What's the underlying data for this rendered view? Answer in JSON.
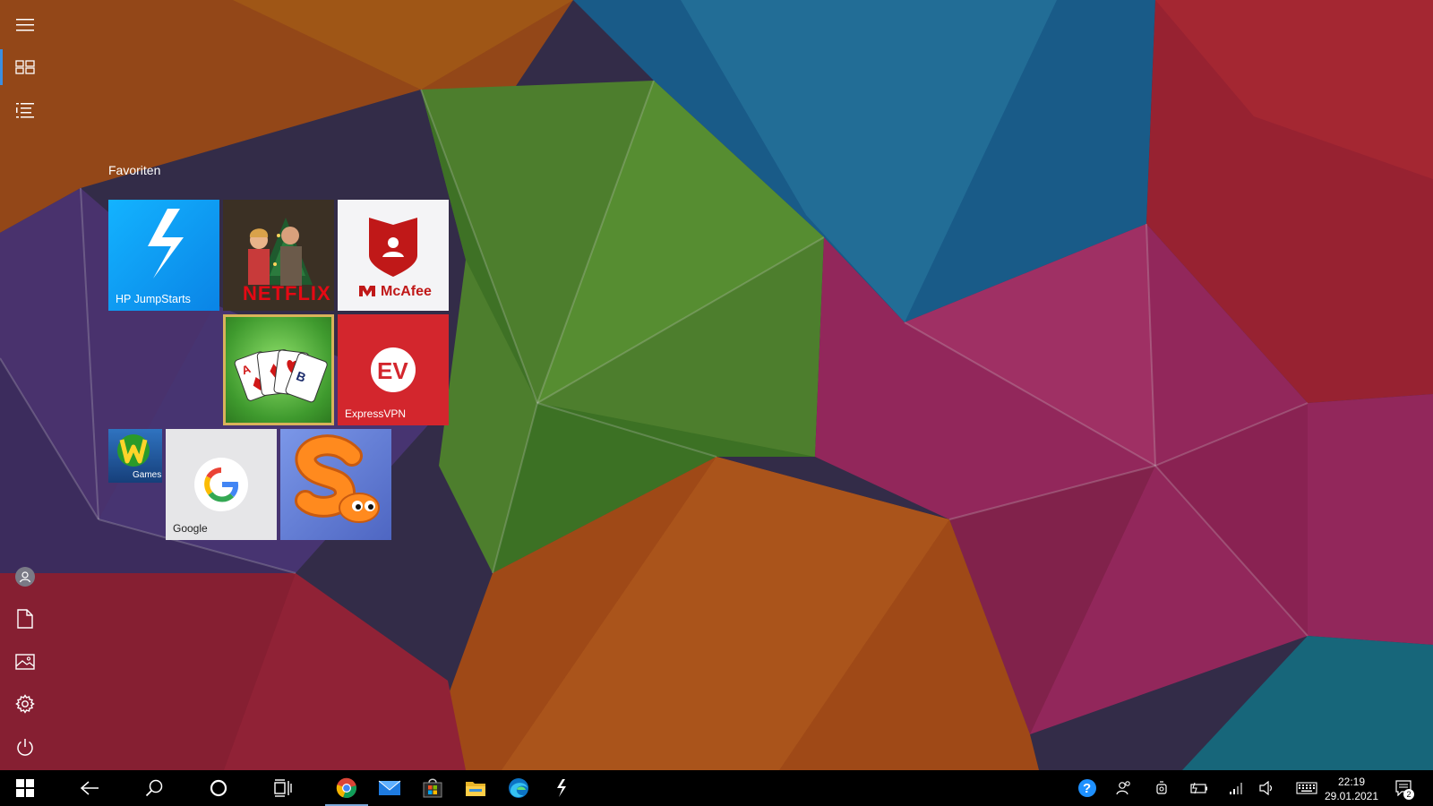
{
  "start": {
    "group_title": "Favoriten",
    "rail_icons": [
      "hamburger-icon",
      "tiles-icon",
      "all-apps-list-icon",
      "user-avatar-icon",
      "documents-icon",
      "pictures-icon",
      "settings-icon",
      "power-icon"
    ],
    "tiles": [
      {
        "name": "HP JumpStarts",
        "label": "HP JumpStarts",
        "bg": "#0a9bf0"
      },
      {
        "name": "Netflix",
        "label": "",
        "logo": "NETFLIX",
        "bg": "#3a2b22"
      },
      {
        "name": "McAfee",
        "label": "",
        "logo": "McAfee",
        "bg": "#f4f4f6"
      },
      {
        "name": "Solitaire",
        "label": "",
        "bg": "#3f9a2e"
      },
      {
        "name": "ExpressVPN",
        "label": "ExpressVPN",
        "bg": "#d3262d"
      },
      {
        "name": "WildTangent Games",
        "label": "Games",
        "bg": "#1e5fa8"
      },
      {
        "name": "Google",
        "label": "Google",
        "bg": "#e6e6e8"
      },
      {
        "name": "Slither",
        "label": "",
        "bg": "#6a86d8"
      }
    ]
  },
  "taskbar": {
    "pinned": [
      "windows-start-icon",
      "back-icon",
      "search-icon",
      "cortana-icon",
      "task-view-icon",
      "chrome-icon",
      "mail-icon",
      "store-icon",
      "file-explorer-icon",
      "edge-icon",
      "hp-jumpstarts-icon"
    ],
    "tray": [
      "help-icon",
      "people-icon",
      "meet-now-icon",
      "battery-icon",
      "wifi-icon",
      "volume-icon",
      "keyboard-icon"
    ],
    "time": "22:19",
    "date": "29.01.2021",
    "notification_count": "2"
  },
  "colors": {
    "accent": "#3b8ee0",
    "taskbar": "#000000"
  }
}
